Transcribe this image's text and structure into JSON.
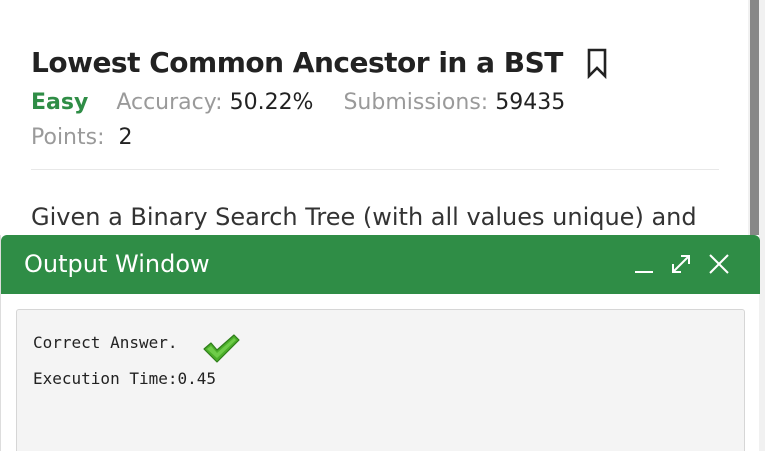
{
  "problem": {
    "title": "Lowest Common Ancestor in a BST",
    "difficulty": "Easy",
    "accuracy_label": "Accuracy:",
    "accuracy_value": "50.22%",
    "submissions_label": "Submissions:",
    "submissions_value": "59435",
    "points_label": "Points:",
    "points_value": "2",
    "description": "Given a Binary Search Tree (with all values unique) and",
    "bookmark_icon": "bookmark-icon"
  },
  "output_window": {
    "title": "Output Window",
    "controls": [
      "minimize-icon",
      "expand-icon",
      "close-icon"
    ],
    "result_text": "Correct Answer.",
    "execution_label": "Execution Time:0.45"
  },
  "colors": {
    "accent": "#2f8d46",
    "muted": "#9a9a9a"
  }
}
